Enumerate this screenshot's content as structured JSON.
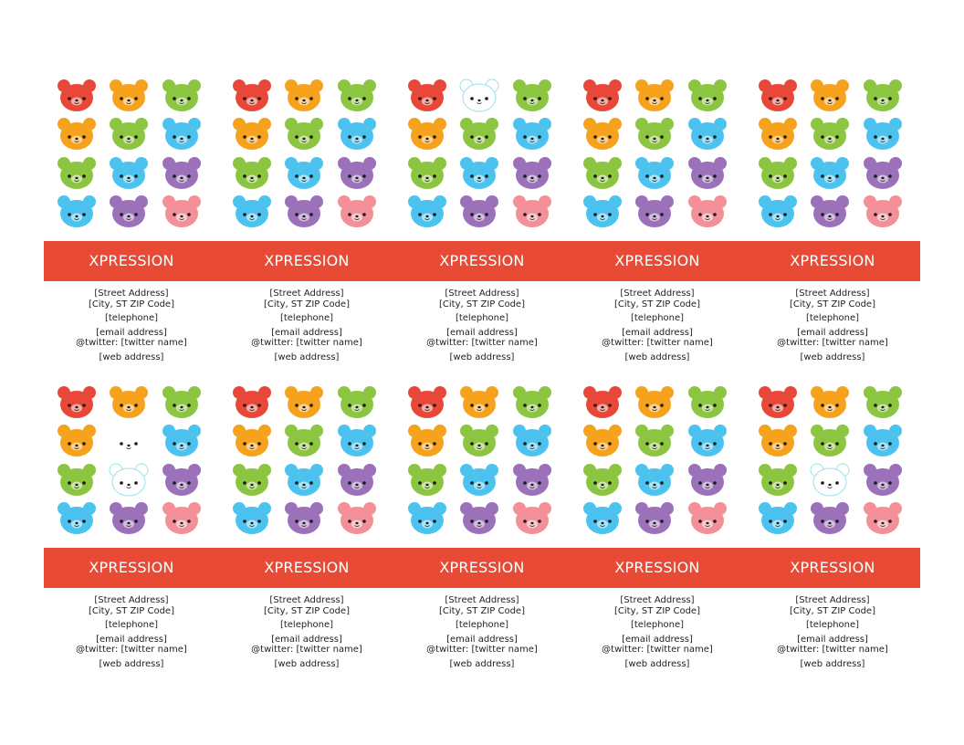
{
  "colors": {
    "band": "#e84a35",
    "red": "#e8473a",
    "orange": "#f7a21c",
    "green": "#8cc540",
    "blue": "#4cc3ef",
    "purple": "#9b72b9",
    "pink": "#f39097",
    "white": "#ffffff"
  },
  "bear_grid_default": [
    [
      "red",
      "orange",
      "green"
    ],
    [
      "orange",
      "green",
      "blue"
    ],
    [
      "green",
      "blue",
      "purple"
    ],
    [
      "blue",
      "purple",
      "pink"
    ]
  ],
  "cards": [
    {
      "title": "XPRESSION",
      "street": "[Street Address]",
      "city": "[City, ST  ZIP Code]",
      "phone": "[telephone]",
      "email": "[email address]",
      "twitter": "@twitter: [twitter name]",
      "web": "[web address]"
    },
    {
      "title": "XPRESSION",
      "street": "[Street Address]",
      "city": "[City, ST  ZIP Code]",
      "phone": "[telephone]",
      "email": "[email address]",
      "twitter": "@twitter: [twitter name]",
      "web": "[web address]"
    },
    {
      "title": "XPRESSION",
      "street": "[Street Address]",
      "city": "[City, ST  ZIP Code]",
      "phone": "[telephone]",
      "email": "[email address]",
      "twitter": "@twitter: [twitter name]",
      "web": "[web address]"
    },
    {
      "title": "XPRESSION",
      "street": "[Street Address]",
      "city": "[City, ST  ZIP Code]",
      "phone": "[telephone]",
      "email": "[email address]",
      "twitter": "@twitter: [twitter name]",
      "web": "[web address]"
    },
    {
      "title": "XPRESSION",
      "street": "[Street Address]",
      "city": "[City, ST  ZIP Code]",
      "phone": "[telephone]",
      "email": "[email address]",
      "twitter": "@twitter: [twitter name]",
      "web": "[web address]"
    },
    {
      "title": "XPRESSION",
      "street": "[Street Address]",
      "city": "[City, ST  ZIP Code]",
      "phone": "[telephone]",
      "email": "[email address]",
      "twitter": "@twitter: [twitter name]",
      "web": "[web address]"
    },
    {
      "title": "XPRESSION",
      "street": "[Street Address]",
      "city": "[City, ST  ZIP Code]",
      "phone": "[telephone]",
      "email": "[email address]",
      "twitter": "@twitter: [twitter name]",
      "web": "[web address]"
    },
    {
      "title": "XPRESSION",
      "street": "[Street Address]",
      "city": "[City, ST  ZIP Code]",
      "phone": "[telephone]",
      "email": "[email address]",
      "twitter": "@twitter: [twitter name]",
      "web": "[web address]"
    },
    {
      "title": "XPRESSION",
      "street": "[Street Address]",
      "city": "[City, ST  ZIP Code]",
      "phone": "[telephone]",
      "email": "[email address]",
      "twitter": "@twitter: [twitter name]",
      "web": "[web address]"
    },
    {
      "title": "XPRESSION",
      "street": "[Street Address]",
      "city": "[City, ST  ZIP Code]",
      "phone": "[telephone]",
      "email": "[email address]",
      "twitter": "@twitter: [twitter name]",
      "web": "[web address]"
    }
  ],
  "white_bears": [
    {
      "card": 2,
      "row": 0,
      "col": 1,
      "style": "outline"
    },
    {
      "card": 5,
      "row": 1,
      "col": 1,
      "style": "face-only"
    },
    {
      "card": 5,
      "row": 2,
      "col": 1,
      "style": "outline"
    },
    {
      "card": 9,
      "row": 2,
      "col": 1,
      "style": "outline"
    }
  ]
}
